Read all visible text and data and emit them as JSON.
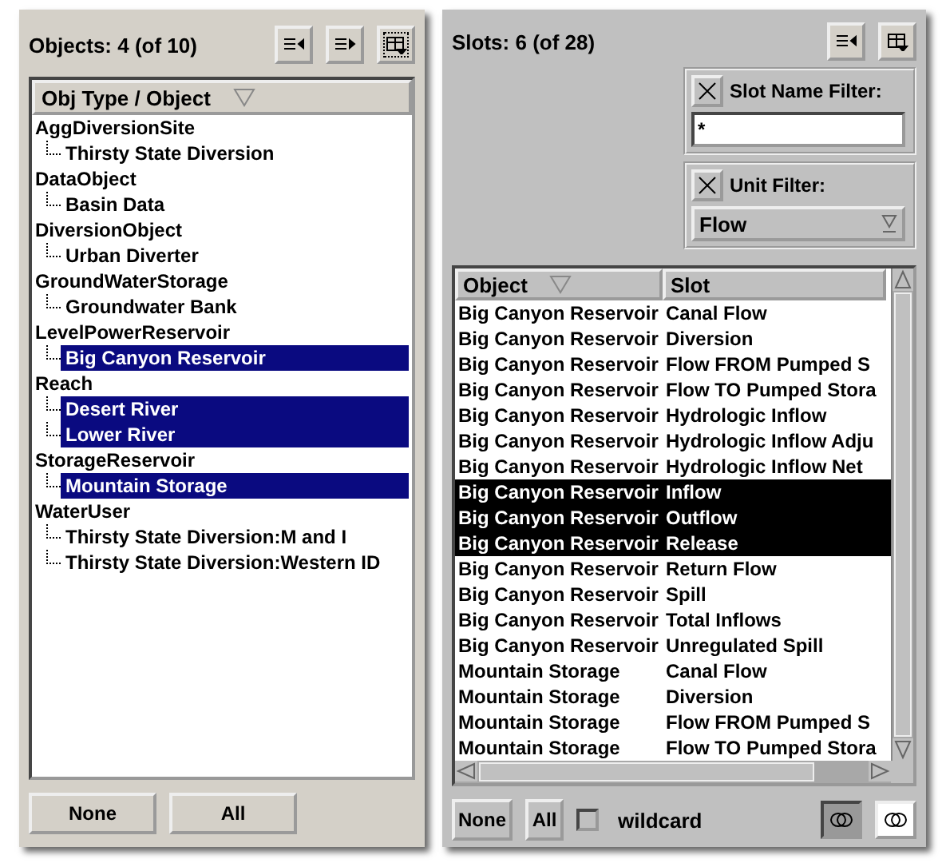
{
  "objects_panel": {
    "title": "Objects: 4 (of 10)",
    "column": "Obj Type / Object",
    "tree": [
      {
        "label": "AggDiversionSite",
        "children": [
          {
            "label": "Thirsty State Diversion",
            "selected": false
          }
        ]
      },
      {
        "label": "DataObject",
        "children": [
          {
            "label": "Basin Data",
            "selected": false
          }
        ]
      },
      {
        "label": "DiversionObject",
        "children": [
          {
            "label": "Urban Diverter",
            "selected": false
          }
        ]
      },
      {
        "label": "GroundWaterStorage",
        "children": [
          {
            "label": "Groundwater Bank",
            "selected": false
          }
        ]
      },
      {
        "label": "LevelPowerReservoir",
        "children": [
          {
            "label": "Big Canyon Reservoir",
            "selected": true
          }
        ]
      },
      {
        "label": "Reach",
        "children": [
          {
            "label": "Desert River",
            "selected": true
          },
          {
            "label": "Lower River",
            "selected": true
          }
        ]
      },
      {
        "label": "StorageReservoir",
        "children": [
          {
            "label": "Mountain Storage",
            "selected": true
          }
        ]
      },
      {
        "label": "WaterUser",
        "children": [
          {
            "label": "Thirsty State Diversion:M and I",
            "selected": false
          },
          {
            "label": "Thirsty State Diversion:Western ID",
            "selected": false
          }
        ]
      }
    ],
    "buttons": [
      "None",
      "All"
    ]
  },
  "slots_panel": {
    "title": "Slots: 6 (of 28)",
    "slot_name_filter": {
      "label": "Slot Name Filter:",
      "checked": true,
      "value": "*"
    },
    "unit_filter": {
      "label": "Unit Filter:",
      "checked": true,
      "value": "Flow"
    },
    "columns": [
      "Object",
      "Slot"
    ],
    "rows": [
      {
        "object": "Big Canyon Reservoir",
        "slot": "Canal Flow",
        "selected": false
      },
      {
        "object": "Big Canyon Reservoir",
        "slot": "Diversion",
        "selected": false
      },
      {
        "object": "Big Canyon Reservoir",
        "slot": "Flow FROM Pumped S",
        "selected": false
      },
      {
        "object": "Big Canyon Reservoir",
        "slot": "Flow TO Pumped Stora",
        "selected": false
      },
      {
        "object": "Big Canyon Reservoir",
        "slot": "Hydrologic Inflow",
        "selected": false
      },
      {
        "object": "Big Canyon Reservoir",
        "slot": "Hydrologic Inflow Adju",
        "selected": false
      },
      {
        "object": "Big Canyon Reservoir",
        "slot": "Hydrologic Inflow Net",
        "selected": false
      },
      {
        "object": "Big Canyon Reservoir",
        "slot": "Inflow",
        "selected": true
      },
      {
        "object": "Big Canyon Reservoir",
        "slot": "Outflow",
        "selected": true
      },
      {
        "object": "Big Canyon Reservoir",
        "slot": "Release",
        "selected": true
      },
      {
        "object": "Big Canyon Reservoir",
        "slot": "Return Flow",
        "selected": false
      },
      {
        "object": "Big Canyon Reservoir",
        "slot": "Spill",
        "selected": false
      },
      {
        "object": "Big Canyon Reservoir",
        "slot": "Total Inflows",
        "selected": false
      },
      {
        "object": "Big Canyon Reservoir",
        "slot": "Unregulated Spill",
        "selected": false
      },
      {
        "object": "Mountain Storage",
        "slot": "Canal Flow",
        "selected": false
      },
      {
        "object": "Mountain Storage",
        "slot": "Diversion",
        "selected": false
      },
      {
        "object": "Mountain Storage",
        "slot": "Flow FROM Pumped S",
        "selected": false
      },
      {
        "object": "Mountain Storage",
        "slot": "Flow TO Pumped Stora",
        "selected": false
      }
    ],
    "buttons": [
      "None",
      "All"
    ],
    "wildcard": {
      "label": "wildcard",
      "checked": false
    },
    "toggles": [
      {
        "selected": true
      },
      {
        "selected": false
      }
    ]
  }
}
